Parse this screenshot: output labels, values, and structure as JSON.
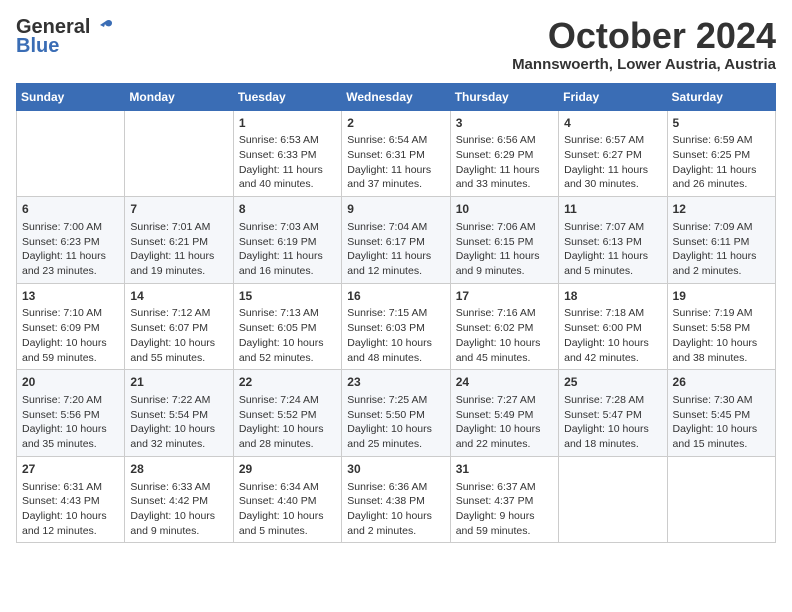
{
  "logo": {
    "general": "General",
    "blue": "Blue"
  },
  "title": "October 2024",
  "subtitle": "Mannswoerth, Lower Austria, Austria",
  "headers": [
    "Sunday",
    "Monday",
    "Tuesday",
    "Wednesday",
    "Thursday",
    "Friday",
    "Saturday"
  ],
  "weeks": [
    [
      {
        "num": "",
        "info": ""
      },
      {
        "num": "",
        "info": ""
      },
      {
        "num": "1",
        "info": "Sunrise: 6:53 AM\nSunset: 6:33 PM\nDaylight: 11 hours and 40 minutes."
      },
      {
        "num": "2",
        "info": "Sunrise: 6:54 AM\nSunset: 6:31 PM\nDaylight: 11 hours and 37 minutes."
      },
      {
        "num": "3",
        "info": "Sunrise: 6:56 AM\nSunset: 6:29 PM\nDaylight: 11 hours and 33 minutes."
      },
      {
        "num": "4",
        "info": "Sunrise: 6:57 AM\nSunset: 6:27 PM\nDaylight: 11 hours and 30 minutes."
      },
      {
        "num": "5",
        "info": "Sunrise: 6:59 AM\nSunset: 6:25 PM\nDaylight: 11 hours and 26 minutes."
      }
    ],
    [
      {
        "num": "6",
        "info": "Sunrise: 7:00 AM\nSunset: 6:23 PM\nDaylight: 11 hours and 23 minutes."
      },
      {
        "num": "7",
        "info": "Sunrise: 7:01 AM\nSunset: 6:21 PM\nDaylight: 11 hours and 19 minutes."
      },
      {
        "num": "8",
        "info": "Sunrise: 7:03 AM\nSunset: 6:19 PM\nDaylight: 11 hours and 16 minutes."
      },
      {
        "num": "9",
        "info": "Sunrise: 7:04 AM\nSunset: 6:17 PM\nDaylight: 11 hours and 12 minutes."
      },
      {
        "num": "10",
        "info": "Sunrise: 7:06 AM\nSunset: 6:15 PM\nDaylight: 11 hours and 9 minutes."
      },
      {
        "num": "11",
        "info": "Sunrise: 7:07 AM\nSunset: 6:13 PM\nDaylight: 11 hours and 5 minutes."
      },
      {
        "num": "12",
        "info": "Sunrise: 7:09 AM\nSunset: 6:11 PM\nDaylight: 11 hours and 2 minutes."
      }
    ],
    [
      {
        "num": "13",
        "info": "Sunrise: 7:10 AM\nSunset: 6:09 PM\nDaylight: 10 hours and 59 minutes."
      },
      {
        "num": "14",
        "info": "Sunrise: 7:12 AM\nSunset: 6:07 PM\nDaylight: 10 hours and 55 minutes."
      },
      {
        "num": "15",
        "info": "Sunrise: 7:13 AM\nSunset: 6:05 PM\nDaylight: 10 hours and 52 minutes."
      },
      {
        "num": "16",
        "info": "Sunrise: 7:15 AM\nSunset: 6:03 PM\nDaylight: 10 hours and 48 minutes."
      },
      {
        "num": "17",
        "info": "Sunrise: 7:16 AM\nSunset: 6:02 PM\nDaylight: 10 hours and 45 minutes."
      },
      {
        "num": "18",
        "info": "Sunrise: 7:18 AM\nSunset: 6:00 PM\nDaylight: 10 hours and 42 minutes."
      },
      {
        "num": "19",
        "info": "Sunrise: 7:19 AM\nSunset: 5:58 PM\nDaylight: 10 hours and 38 minutes."
      }
    ],
    [
      {
        "num": "20",
        "info": "Sunrise: 7:20 AM\nSunset: 5:56 PM\nDaylight: 10 hours and 35 minutes."
      },
      {
        "num": "21",
        "info": "Sunrise: 7:22 AM\nSunset: 5:54 PM\nDaylight: 10 hours and 32 minutes."
      },
      {
        "num": "22",
        "info": "Sunrise: 7:24 AM\nSunset: 5:52 PM\nDaylight: 10 hours and 28 minutes."
      },
      {
        "num": "23",
        "info": "Sunrise: 7:25 AM\nSunset: 5:50 PM\nDaylight: 10 hours and 25 minutes."
      },
      {
        "num": "24",
        "info": "Sunrise: 7:27 AM\nSunset: 5:49 PM\nDaylight: 10 hours and 22 minutes."
      },
      {
        "num": "25",
        "info": "Sunrise: 7:28 AM\nSunset: 5:47 PM\nDaylight: 10 hours and 18 minutes."
      },
      {
        "num": "26",
        "info": "Sunrise: 7:30 AM\nSunset: 5:45 PM\nDaylight: 10 hours and 15 minutes."
      }
    ],
    [
      {
        "num": "27",
        "info": "Sunrise: 6:31 AM\nSunset: 4:43 PM\nDaylight: 10 hours and 12 minutes."
      },
      {
        "num": "28",
        "info": "Sunrise: 6:33 AM\nSunset: 4:42 PM\nDaylight: 10 hours and 9 minutes."
      },
      {
        "num": "29",
        "info": "Sunrise: 6:34 AM\nSunset: 4:40 PM\nDaylight: 10 hours and 5 minutes."
      },
      {
        "num": "30",
        "info": "Sunrise: 6:36 AM\nSunset: 4:38 PM\nDaylight: 10 hours and 2 minutes."
      },
      {
        "num": "31",
        "info": "Sunrise: 6:37 AM\nSunset: 4:37 PM\nDaylight: 9 hours and 59 minutes."
      },
      {
        "num": "",
        "info": ""
      },
      {
        "num": "",
        "info": ""
      }
    ]
  ]
}
